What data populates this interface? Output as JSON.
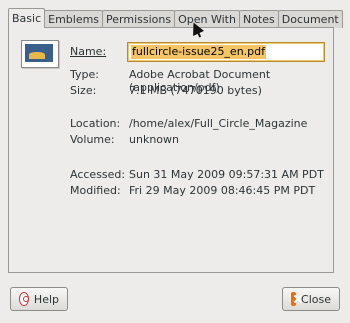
{
  "tabs": [
    {
      "label": "Basic"
    },
    {
      "label": "Emblems"
    },
    {
      "label": "Permissions"
    },
    {
      "label": "Open With"
    },
    {
      "label": "Notes"
    },
    {
      "label": "Document"
    }
  ],
  "file": {
    "name_label": "Name:",
    "name_value": "fullcircle-issue25_en.pdf",
    "type_label": "Type:",
    "type_value": "Adobe Acrobat Document (application/pdf)",
    "size_label": "Size:",
    "size_value": "7.1 MB (7470190 bytes)",
    "location_label": "Location:",
    "location_value": "/home/alex/Full_Circle_Magazine",
    "volume_label": "Volume:",
    "volume_value": "unknown",
    "accessed_label": "Accessed:",
    "accessed_value": "Sun 31 May 2009 09:57:31 AM PDT",
    "modified_label": "Modified:",
    "modified_value": "Fri 29 May 2009 08:46:45 PM PDT"
  },
  "buttons": {
    "help_label": "Help",
    "close_label": "Close"
  },
  "icons": {
    "help": "help-icon",
    "close": "close-icon",
    "file": "file-thumbnail-icon"
  }
}
